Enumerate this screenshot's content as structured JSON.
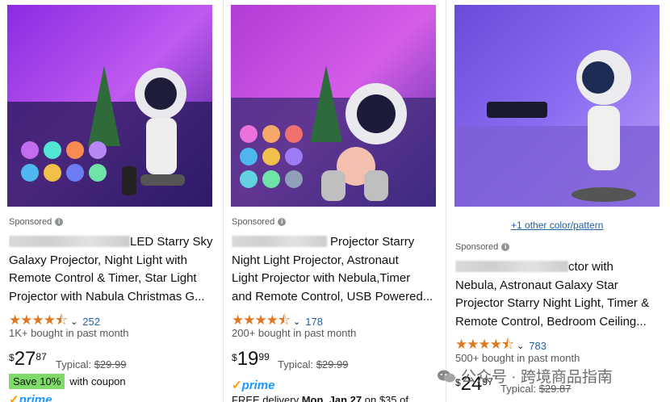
{
  "cards": [
    {
      "sponsored": "Sponsored",
      "title_lines": [
        "LED Starry Sky",
        "Galaxy Projector, Night Light with",
        "Remote Control & Timer, Star Light",
        "Projector with Nabula Christmas G..."
      ],
      "rating_stars": "★★★★⯪",
      "rating_count": "252",
      "bought": "1K+ bought in past month",
      "price_currency": "$",
      "price_whole": "27",
      "price_fraction": "87",
      "typical_label": "Typical:",
      "typical_price": "$29.99",
      "save_badge": "Save 10%",
      "save_text": "with coupon",
      "prime": "prime"
    },
    {
      "sponsored": "Sponsored",
      "title_lines": [
        "Projector Starry",
        "Night Light Projector, Astronaut",
        "Light Projector with Nebula,Timer",
        "and Remote Control, USB Powered..."
      ],
      "rating_stars": "★★★★⯪",
      "rating_count": "178",
      "bought": "200+ bought in past month",
      "price_currency": "$",
      "price_whole": "19",
      "price_fraction": "99",
      "typical_label": "Typical:",
      "typical_price": "$29.99",
      "prime": "prime",
      "delivery_prefix": "FREE delivery",
      "delivery_date": "Mon, Jan 27",
      "delivery_suffix": "on $35 of"
    },
    {
      "other_link": "+1 other color/pattern",
      "sponsored": "Sponsored",
      "title_lines": [
        "ctor with",
        "Nebula, Astronaut Galaxy Star",
        "Projector Starry Night Light, Timer &",
        "Remote Control, Bedroom Ceiling..."
      ],
      "rating_stars": "★★★★⯪",
      "rating_count": "783",
      "bought": "500+ bought in past month",
      "price_currency": "$",
      "price_whole": "24",
      "price_fraction": "97",
      "typical_label": "Typical:",
      "typical_price": "$29.87"
    }
  ],
  "watermark": {
    "text": "公众号 · 跨境商品指南"
  },
  "colors": {
    "star": "#de7921",
    "link": "#2162a1",
    "save_badge": "#7fda69",
    "prime": "#1a98ff"
  },
  "icons": {
    "info": "info-icon",
    "chevron": "chevron-down-icon",
    "wechat": "wechat-icon"
  }
}
